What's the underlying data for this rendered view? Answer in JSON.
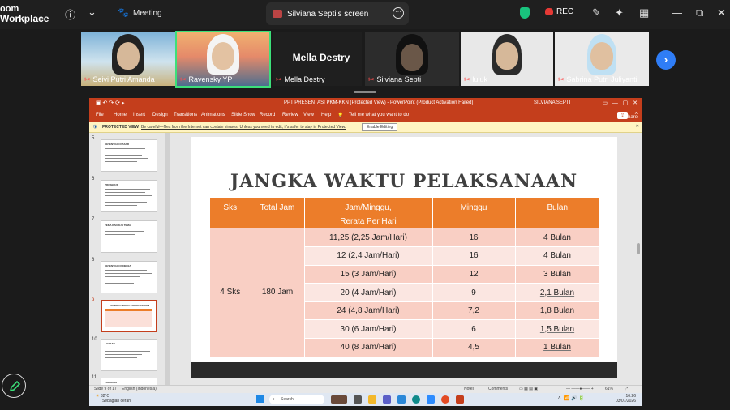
{
  "zoom": {
    "app_name_line1": "oom",
    "app_name_line2": "Workplace",
    "meeting_label": "Meeting",
    "screen_share_label": "Silviana Septi's screen",
    "rec_label": "REC"
  },
  "participants": [
    {
      "name": "Seivi Putri Amanda",
      "muted": true
    },
    {
      "name": "Ravensky YP",
      "muted": true,
      "active": true
    },
    {
      "name": "Mella Destry",
      "muted": true,
      "video_off": true
    },
    {
      "name": "Silviana Septi",
      "muted": true
    },
    {
      "name": "luluk",
      "muted": true
    },
    {
      "name": "Sabrina Putri Juliyanti",
      "muted": true
    }
  ],
  "big_name": "Mella Destry",
  "powerpoint": {
    "title": "PPT PRESENTASI PKM-KKN (Protected View)  -  PowerPoint (Product Activation Failed)",
    "user": "SILVIANA SEPTI",
    "ribbon_tabs": [
      "File",
      "Home",
      "Insert",
      "Design",
      "Transitions",
      "Animations",
      "Slide Show",
      "Record",
      "Review",
      "View",
      "Help"
    ],
    "tell_me": "Tell me what you want to do",
    "share_label": "Share",
    "protected_view_label": "PROTECTED VIEW",
    "protected_view_msg": "Be careful—files from the Internet can contain viruses. Unless you need to edit, it's safer to stay in Protected View.",
    "enable_editing": "Enable Editing",
    "thumbnails": [
      {
        "num": "5",
        "title": "KETENTUAN DASAR"
      },
      {
        "num": "6",
        "title": "PROSEDUR"
      },
      {
        "num": "7",
        "title": "TEMA DAN SUB TEMA"
      },
      {
        "num": "8",
        "title": "KETENTUAN KINERJA"
      },
      {
        "num": "9",
        "title": "JANGKA WAKTU PELAKSANAAN",
        "selected": true
      },
      {
        "num": "10",
        "title": "LUARAN"
      },
      {
        "num": "11",
        "title": "LAPORAN"
      }
    ],
    "slide": {
      "title": "JANGKA WAKTU PELAKSANAAN",
      "headers": [
        "Sks",
        "Total Jam",
        "Jam/Minggu,",
        "Minggu",
        "Bulan"
      ],
      "header_sub": "Rerata Per Hari",
      "sks": "4 Sks",
      "total_jam": "180 Jam",
      "rows": [
        {
          "jam": "11,25  (2,25 Jam/Hari)",
          "minggu": "16",
          "bulan": "4 Bulan"
        },
        {
          "jam": "12  (2,4 Jam/Hari)",
          "minggu": "16",
          "bulan": "4 Bulan"
        },
        {
          "jam": "15  (3 Jam/Hari)",
          "minggu": "12",
          "bulan": "3 Bulan"
        },
        {
          "jam": "20  (4 Jam/Hari)",
          "minggu": "9",
          "bulan": "2,1 Bulan"
        },
        {
          "jam": "24  (4,8 Jam/Hari)",
          "minggu": "7,2",
          "bulan": "1,8 Bulan"
        },
        {
          "jam": "30  (6 Jam/Hari)",
          "minggu": "6",
          "bulan": "1,5 Bulan"
        },
        {
          "jam": "40  (8 Jam/Hari)",
          "minggu": "4,5",
          "bulan": "1 Bulan"
        }
      ]
    },
    "status_slide": "Slide 9 of 17",
    "status_lang": "English (Indonesia)",
    "status_notes": "Notes",
    "status_comments": "Comments",
    "status_zoom": "61%"
  },
  "taskbar": {
    "temp": "32°C",
    "weather": "Sebagian cerah",
    "search": "Search",
    "time": "16:26",
    "date": "03/07/2026"
  }
}
